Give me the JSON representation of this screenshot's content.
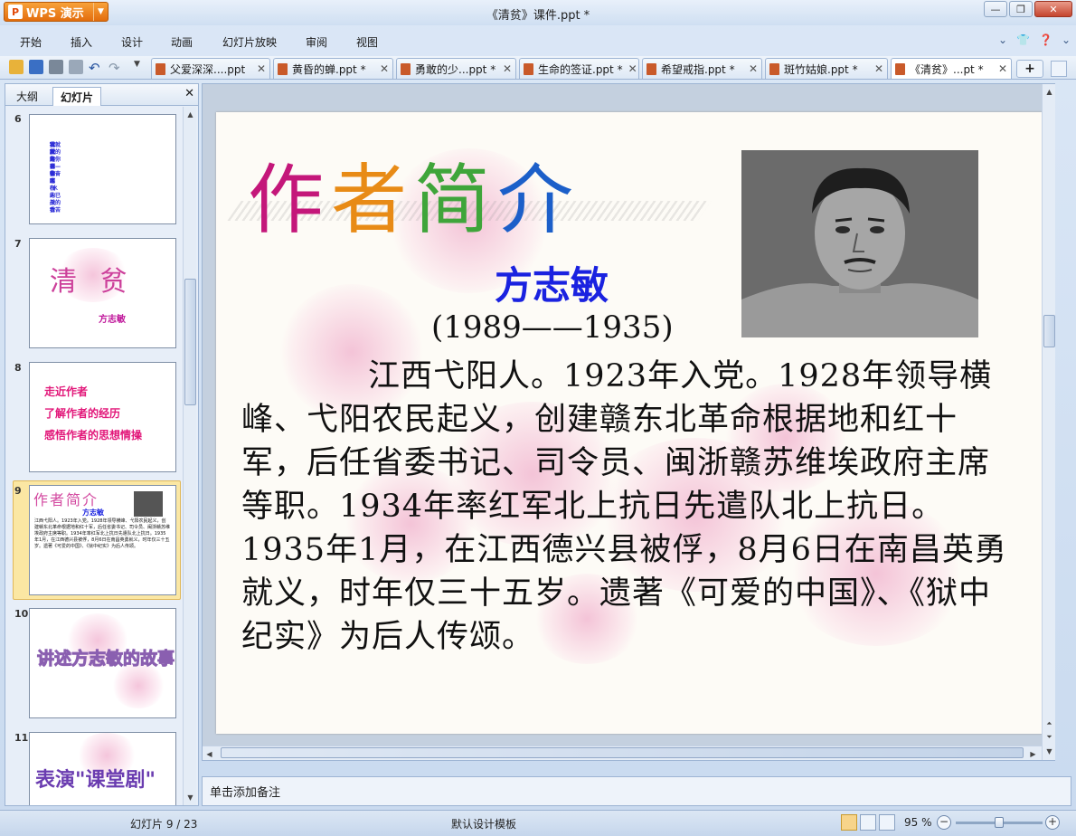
{
  "window": {
    "app_button": "WPS 演示",
    "title": "《清贫》课件.ppt *"
  },
  "menu": [
    "开始",
    "插入",
    "设计",
    "动画",
    "幻灯片放映",
    "审阅",
    "视图"
  ],
  "doc_tabs": [
    {
      "label": "父爱深深....ppt",
      "active": false
    },
    {
      "label": "黄昏的蝉.ppt *",
      "active": false
    },
    {
      "label": "勇敢的少...ppt *",
      "active": false
    },
    {
      "label": "生命的签证.ppt *",
      "active": false
    },
    {
      "label": "希望戒指.ppt *",
      "active": false
    },
    {
      "label": "斑竹姑娘.ppt *",
      "active": false
    },
    {
      "label": "《清贫》...pt *",
      "active": true
    }
  ],
  "panel": {
    "tab_outline": "大纲",
    "tab_slides": "幻灯片"
  },
  "thumbnails": [
    {
      "number": "6",
      "lines": [
        "可爱的母亲呵",
        "我苦斗 我奋斗",
        "我就为了你",
        "我所读到中国 布的天香",
        "我就为了你",
        "我就我的为你——我奋水(水 末已战的我苦"
      ]
    },
    {
      "number": "7",
      "title": "清 贫",
      "subtitle": "方志敏"
    },
    {
      "number": "8",
      "lines": [
        "走近作者",
        "了解作者的经历",
        "感悟作者的思想情操"
      ]
    },
    {
      "number": "9",
      "title": "作者简介",
      "subtitle": "方志敏"
    },
    {
      "number": "10",
      "title": "讲述方志敏的故事"
    },
    {
      "number": "11",
      "title": "表演\"课堂剧\""
    }
  ],
  "slide": {
    "title_chars": [
      "作",
      "者",
      "简",
      "介"
    ],
    "author": "方志敏",
    "years": "(1989——1935)",
    "bio": "江西弋阳人。1923年入党。1928年领导横峰、弋阳农民起义，创建赣东北革命根据地和红十军，后任省委书记、司令员、闽浙赣苏维埃政府主席等职。1934年率红军北上抗日先遣队北上抗日。1935年1月，在江西德兴县被俘，8月6日在南昌英勇就义，时年仅三十五岁。遗著《可爱的中国》、《狱中纪实》为后人传颂。"
  },
  "notes_placeholder": "单击添加备注",
  "status": {
    "slide_counter": "幻灯片 9 / 23",
    "template": "默认设计模板",
    "zoom": "95 %"
  },
  "zoom_fraction": 0.5
}
